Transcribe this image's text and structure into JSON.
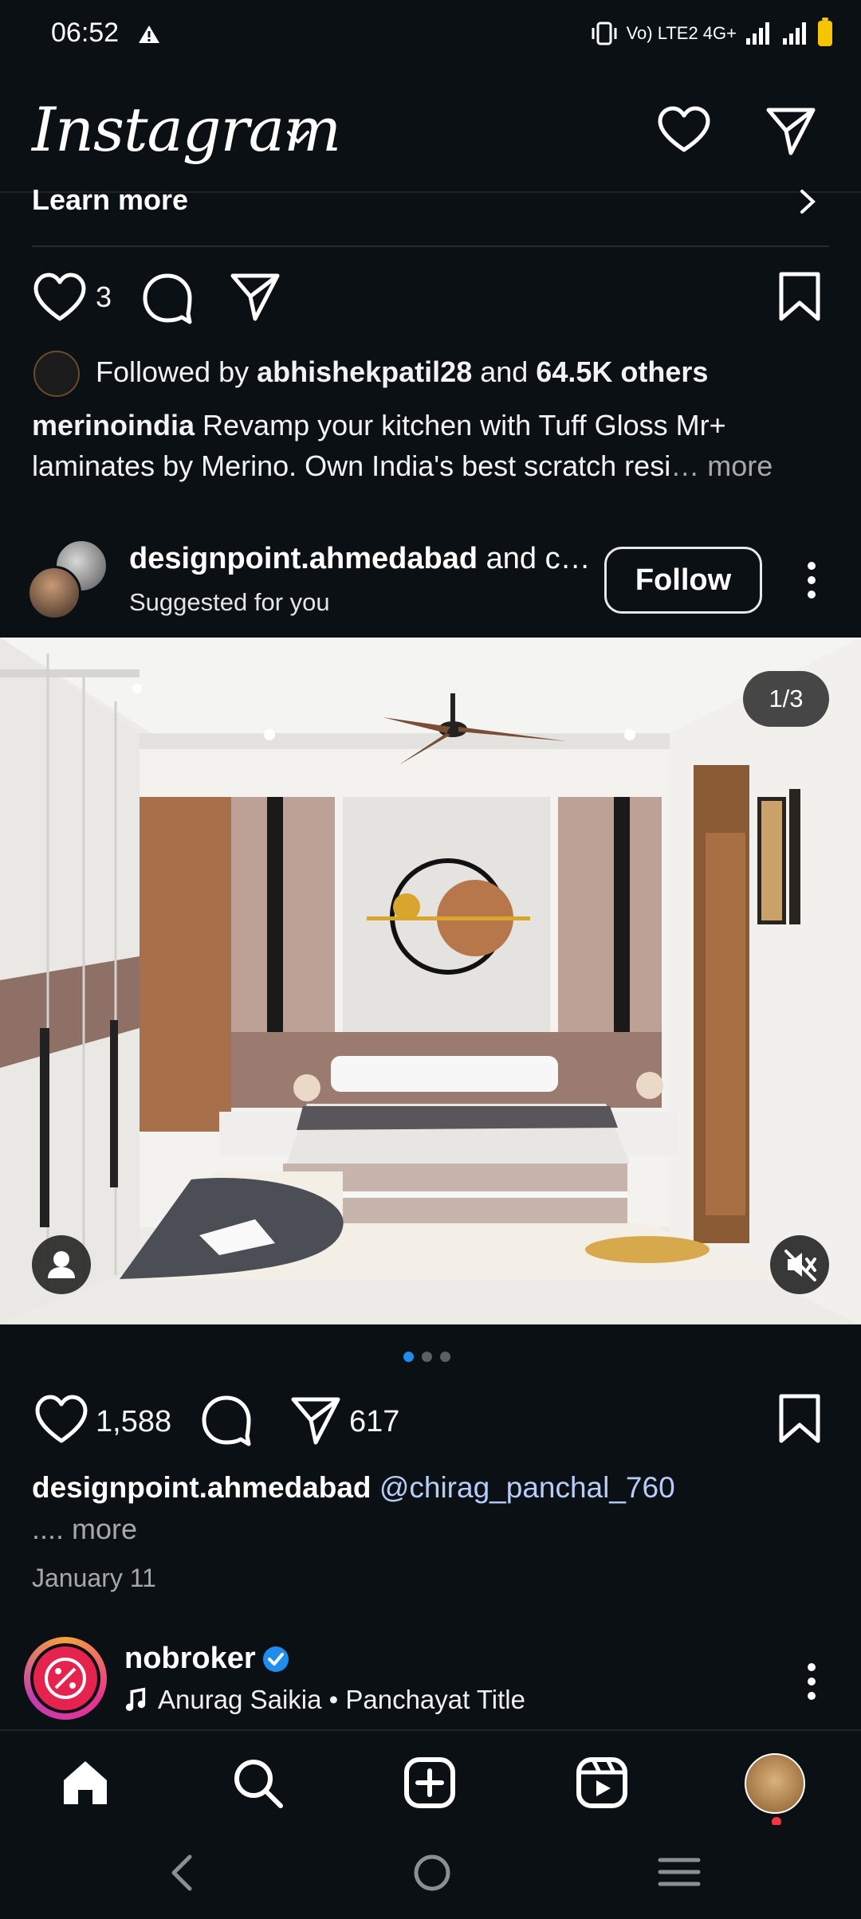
{
  "status_bar": {
    "time": "06:52",
    "network": "Vo) LTE2 4G+",
    "icons": [
      "alert-icon",
      "vibrate-icon",
      "signal-icon",
      "battery-icon"
    ],
    "battery_color": "#f7c500"
  },
  "header": {
    "logo": "Instagram",
    "icons": [
      "chevron-down-icon",
      "heart-icon",
      "send-icon"
    ]
  },
  "ad_post": {
    "cta_label": "Learn more",
    "like_count": "3",
    "followed_by_prefix": "Followed by ",
    "followed_by_user": "abhishekpatil28",
    "followed_by_mid": " and ",
    "followed_by_others": "64.5K others",
    "caption_user": "merinoindia",
    "caption_text": " Revamp your kitchen with Tuff Gloss Mr+ laminates by Merino. Own India's best scratch resi",
    "caption_more": "… more"
  },
  "suggested_post": {
    "username": "designpoint.ahmedabad",
    "username_suffix": " and ch…",
    "subtitle": "Suggested for you",
    "follow_label": "Follow",
    "image_counter": "1/3",
    "carousel_pages": 3,
    "carousel_active": 0,
    "like_count": "1,588",
    "share_count": "617",
    "caption_user": "designpoint.ahmedabad",
    "caption_mention": "@chirag_panchal_760",
    "caption_more": ".... more",
    "date": "January 11"
  },
  "next_post": {
    "username": "nobroker",
    "verified": true,
    "audio": "Anurag Saikia • Panchayat Title",
    "brand_color": "#e6224f"
  },
  "bottom_nav": {
    "items": [
      "home-icon",
      "search-icon",
      "create-icon",
      "reels-icon",
      "profile-avatar"
    ],
    "notification_dot_color": "#ff3040"
  },
  "colors": {
    "background": "#0b1014",
    "accent_blue": "#1f8cf0",
    "mention": "#b6cdf9"
  }
}
